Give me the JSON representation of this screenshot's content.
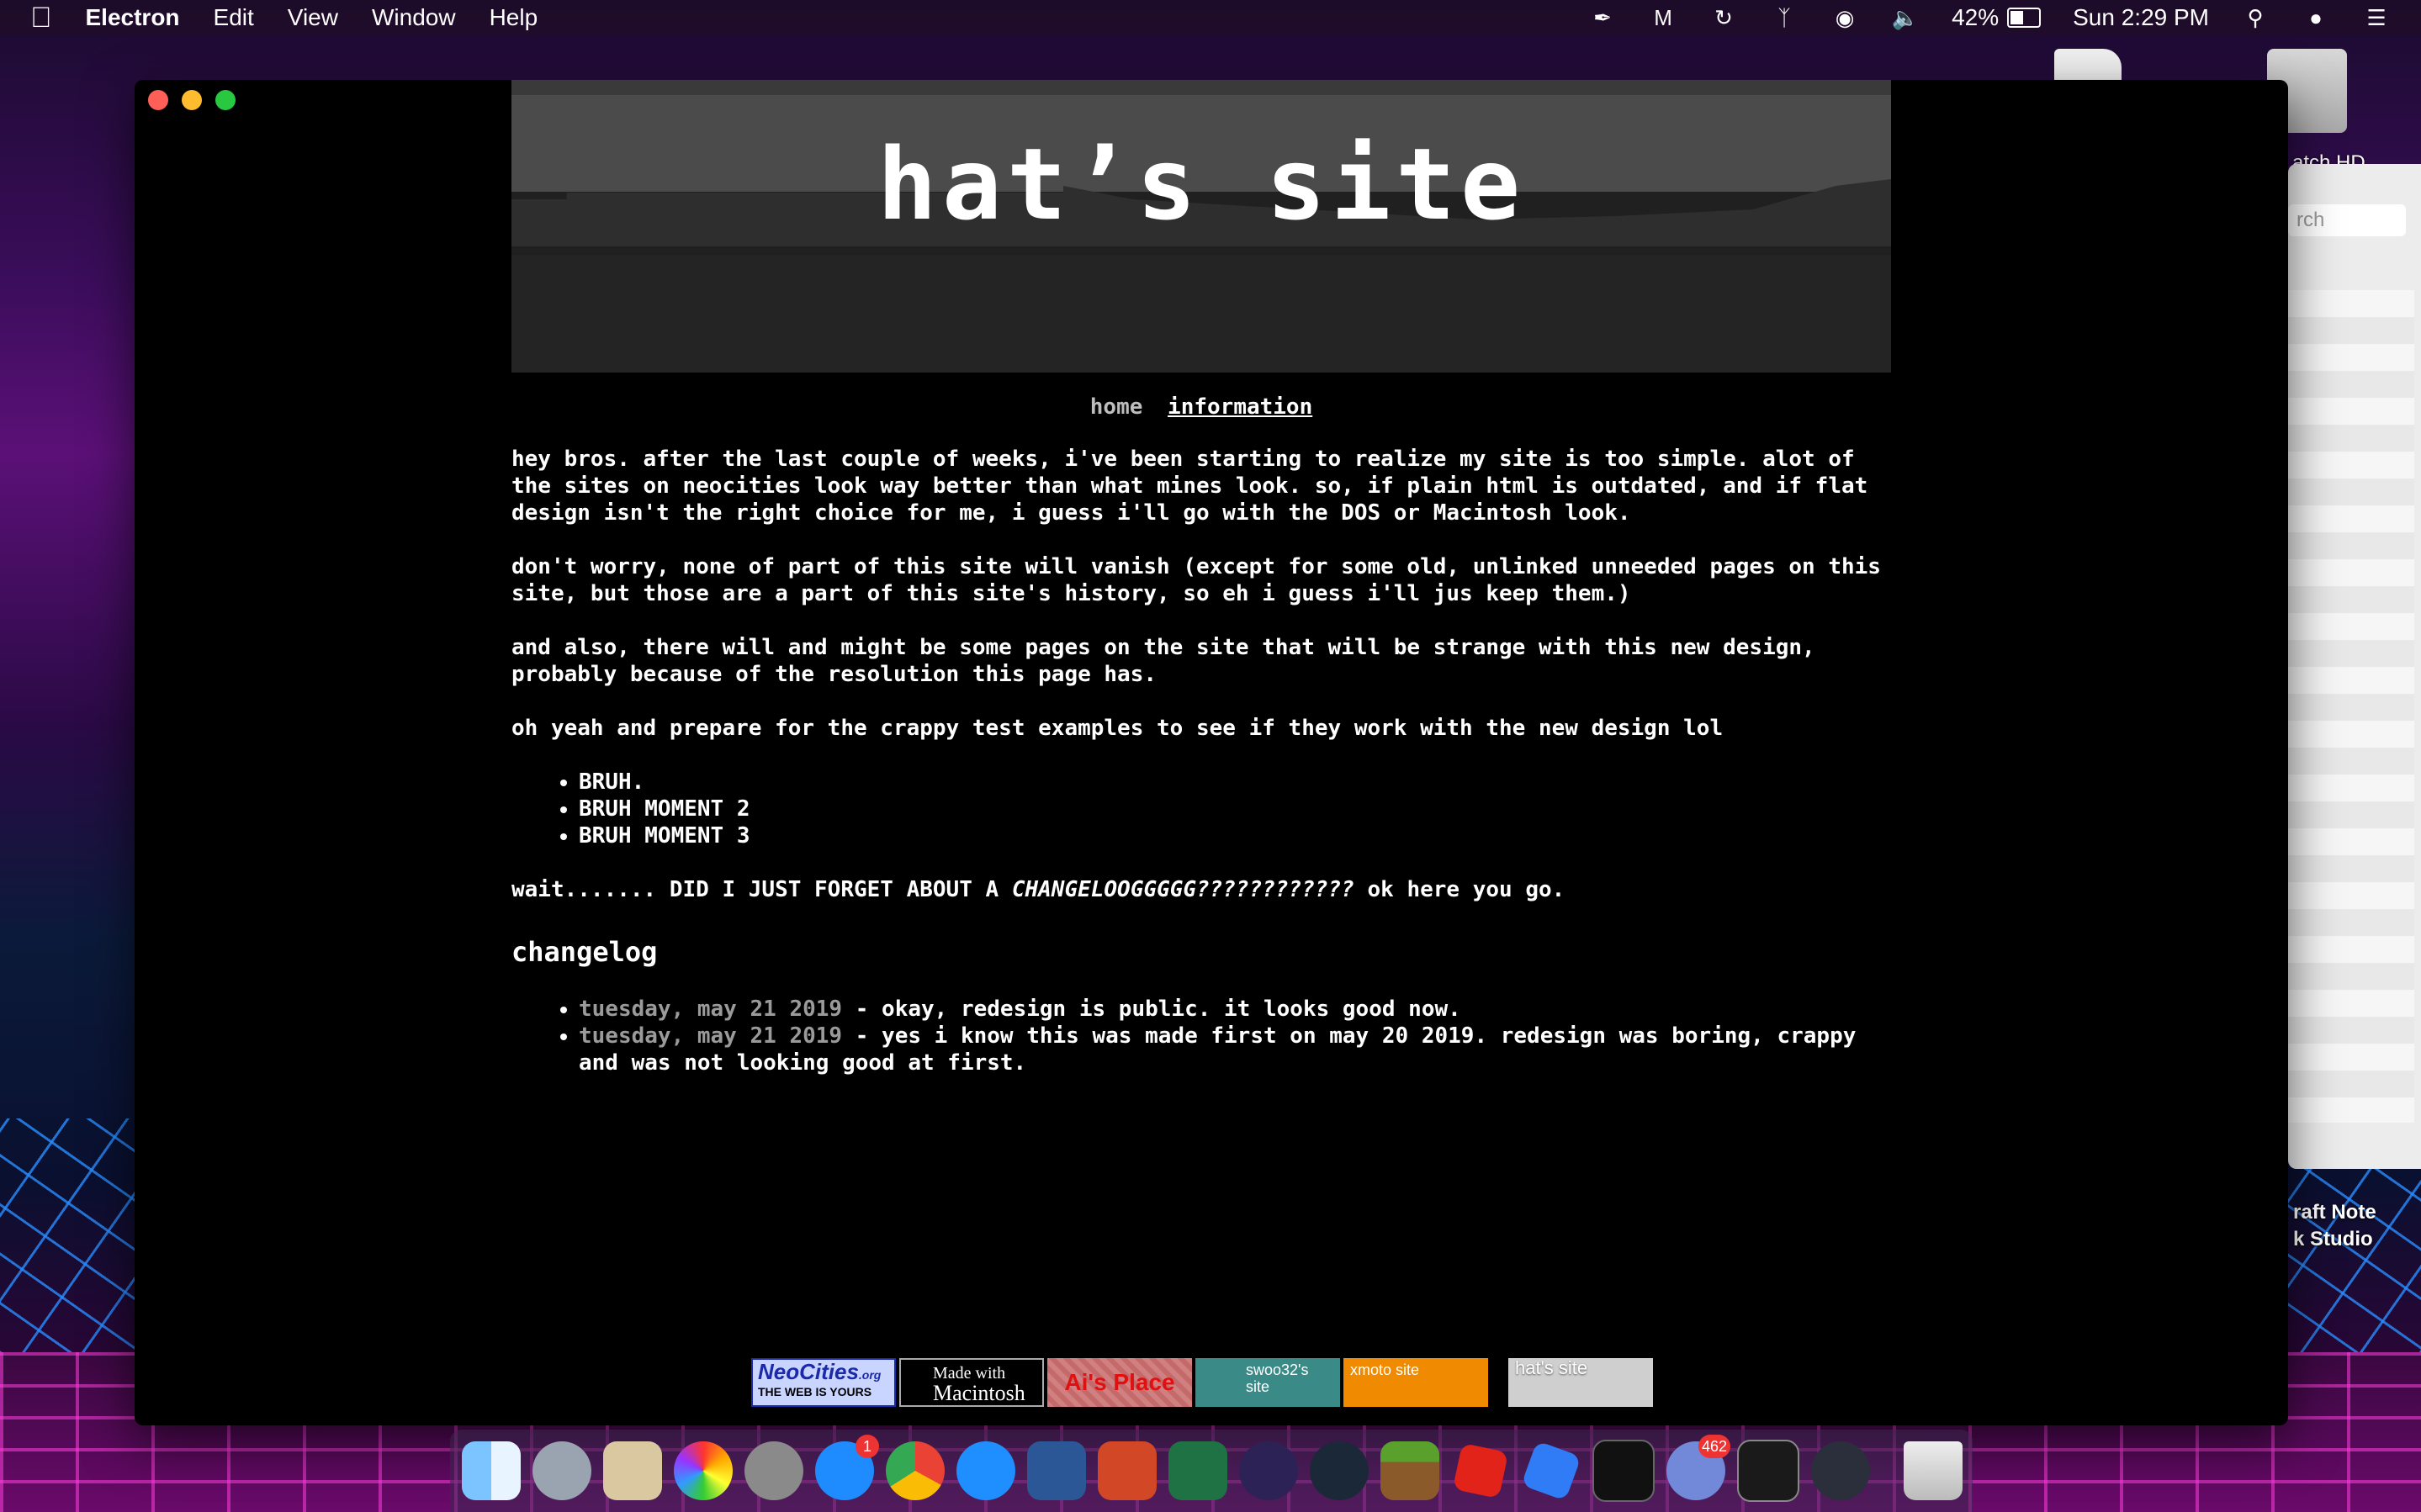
{
  "menubar": {
    "app_name": "Electron",
    "menus": [
      "Edit",
      "View",
      "Window",
      "Help"
    ],
    "battery_percent": "42%",
    "clock": "Sun 2:29 PM"
  },
  "desktop": {
    "hd_label": "atch HD",
    "note_label_1": "raft Note",
    "note_label_2": "k Studio",
    "bg_search_placeholder": "rch"
  },
  "site": {
    "title": "hat’s site",
    "nav": {
      "home": "home",
      "information": "information"
    },
    "paragraphs": [
      "hey bros. after the last couple of weeks, i've been starting to realize my site is too simple. alot of the sites on neocities look way better than what mines look. so, if plain html is outdated, and if flat design isn't the right choice for me, i guess i'll go with the DOS or Macintosh look.",
      "don't worry, none of part of this site will vanish (except for some old, unlinked unneeded pages on this site, but those are a part of this site's history, so eh i guess i'll jus keep them.)",
      "and also, there will and might be some pages on the site that will be strange with this new design, probably because of the resolution this page has.",
      "oh yeah and prepare for the crappy test examples to see if they work with the new design lol"
    ],
    "list": [
      "BRUH.",
      "BRUH MOMENT 2",
      "BRUH MOMENT 3"
    ],
    "wait_line": {
      "before": "wait....... DID I JUST FORGET ABOUT A ",
      "emph": "CHANGELOOGGGGG????????????",
      "after": " ok here you go."
    },
    "changelog_heading": "changelog",
    "changelog": [
      {
        "date": "tuesday, may 21 2019",
        "text": " - okay, redesign is public. it looks good now."
      },
      {
        "date": "tuesday, may 21 2019",
        "text": " - yes i know this was made first on may 20 2019. redesign was boring, crappy and was not looking good at first."
      }
    ],
    "badges": {
      "neocities": "NeoCities",
      "neocities_org": ".org",
      "neocities_tag": "THE WEB IS YOURS",
      "mac_top": "Made with",
      "mac_bottom": "Macintosh",
      "ai": "Ai's Place",
      "swoo": "swoo32's site",
      "xmoto": "xmoto site",
      "hat": "hat's site"
    }
  },
  "dock": {
    "items": [
      "finder",
      "launchpad",
      "preview",
      "photos",
      "system-preferences",
      "app-store",
      "chrome",
      "safari",
      "word",
      "powerpoint",
      "excel",
      "eclipse",
      "steam",
      "minecraft",
      "roblox",
      "roblox-studio",
      "activity-monitor",
      "discord",
      "terminal",
      "electron",
      "trash"
    ],
    "app_store_badge": "1",
    "discord_badge": "462"
  },
  "colors": {
    "close": "#ff5f57",
    "minimize": "#febc2e",
    "maximize": "#28c840",
    "page_bg": "#000000",
    "date": "#9a9a9a"
  }
}
